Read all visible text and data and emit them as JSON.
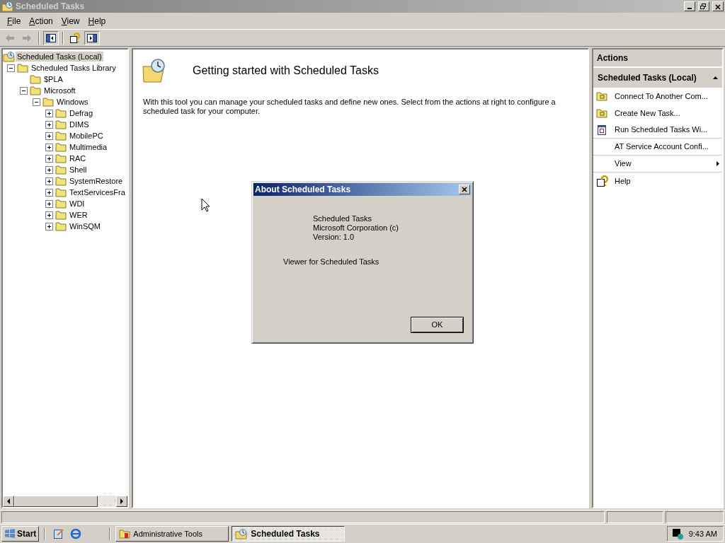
{
  "window": {
    "title": "Scheduled Tasks",
    "active": false
  },
  "menu": [
    "File",
    "Action",
    "View",
    "Help"
  ],
  "tree": [
    {
      "label": "Scheduled Tasks (Local)",
      "selected": true,
      "kind": "root",
      "children": [
        {
          "label": "Scheduled Tasks Library",
          "selected": false,
          "expanded": true,
          "children": [
            {
              "label": "$PLA",
              "selected": false
            },
            {
              "label": "Microsoft",
              "selected": false,
              "expanded": true,
              "children": [
                {
                  "label": "Windows",
                  "selected": false,
                  "expanded": true,
                  "children": [
                    {
                      "label": "Defrag",
                      "selected": false,
                      "expanded": false
                    },
                    {
                      "label": "DIMS",
                      "selected": false,
                      "expanded": false
                    },
                    {
                      "label": "MobilePC",
                      "selected": false,
                      "expanded": false
                    },
                    {
                      "label": "Multimedia",
                      "selected": false,
                      "expanded": false
                    },
                    {
                      "label": "RAC",
                      "selected": false,
                      "expanded": false
                    },
                    {
                      "label": "Shell",
                      "selected": false,
                      "expanded": false
                    },
                    {
                      "label": "SystemRestore",
                      "selected": false,
                      "expanded": false
                    },
                    {
                      "label": "TextServicesFra",
                      "selected": false,
                      "expanded": false
                    },
                    {
                      "label": "WDI",
                      "selected": false,
                      "expanded": false
                    },
                    {
                      "label": "WER",
                      "selected": false,
                      "expanded": false
                    },
                    {
                      "label": "WinSQM",
                      "selected": false,
                      "expanded": false
                    }
                  ]
                }
              ]
            }
          ]
        }
      ]
    }
  ],
  "content": {
    "heading": "Getting started with Scheduled Tasks",
    "text": "With this tool you can manage your scheduled tasks and define new ones.  Select from the actions at right to configure a scheduled task for your computer."
  },
  "actions": {
    "title": "Actions",
    "section": "Scheduled Tasks (Local)",
    "items": [
      {
        "kind": "folder",
        "label": "Connect To Another Com..."
      },
      {
        "kind": "folder",
        "label": "Create New Task..."
      },
      {
        "kind": "window",
        "label": "Run Scheduled Tasks Wi..."
      },
      {
        "kind": "plain",
        "label": "AT Service Account Confi..."
      },
      {
        "kind": "submenu",
        "label": "View"
      },
      {
        "kind": "help",
        "label": "Help"
      }
    ]
  },
  "dialog": {
    "title": "About Scheduled Tasks",
    "lines": [
      "Scheduled Tasks",
      "Microsoft Corporation (c)",
      "Version: 1.0"
    ],
    "description": "Viewer for Scheduled Tasks",
    "button": "OK"
  },
  "taskbar": {
    "start": "Start",
    "buttons": [
      {
        "label": "Administrative Tools",
        "selected": false,
        "kind": "tools"
      },
      {
        "label": "Scheduled Tasks",
        "selected": true,
        "kind": "tasks"
      }
    ],
    "clock": "9:43 AM"
  }
}
